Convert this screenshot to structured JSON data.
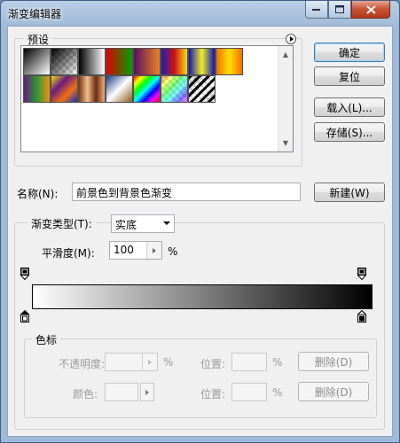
{
  "window": {
    "title": "渐变编辑器"
  },
  "presets": {
    "label": "预设",
    "swatches": [
      {
        "name": "foreground-to-background",
        "bg": "linear-gradient(135deg,#000,#fff)"
      },
      {
        "name": "foreground-to-transparent",
        "bg": "linear-gradient(135deg,#000,rgba(0,0,0,0))"
      },
      {
        "name": "black-white",
        "bg": "linear-gradient(to right,#000,#fff)"
      },
      {
        "name": "red-green",
        "bg": "linear-gradient(to right,#e00000,#00a000)"
      },
      {
        "name": "violet-orange",
        "bg": "linear-gradient(to right,#5a1060,#f08020)"
      },
      {
        "name": "blue-red-yellow",
        "bg": "linear-gradient(to right,#1020c0,#d01010,#f0e010)"
      },
      {
        "name": "blue-yellow-blue",
        "bg": "linear-gradient(to right,#1010c0,#f0f020,#1010c0)"
      },
      {
        "name": "orange-yellow-orange",
        "bg": "linear-gradient(to right,#f07000,#ffe000,#f07000)"
      },
      {
        "name": "violet-green-orange",
        "bg": "linear-gradient(to right,#6a1a80,#2a9a30,#f09010)"
      },
      {
        "name": "yellow-violet-orange-blue",
        "bg": "linear-gradient(135deg,#f0e010,#6a1a80,#f07010,#1030c0)"
      },
      {
        "name": "copper",
        "bg": "linear-gradient(to right,#7a3a10,#f0c090,#6a2a10,#f0b080)"
      },
      {
        "name": "chrome",
        "bg": "linear-gradient(135deg,#1a3a8a,#ffffff 50%,#8a5a20)"
      },
      {
        "name": "spectrum",
        "bg": "linear-gradient(135deg,#f00,#ff0,#0f0,#0ff,#00f,#f0f,#f00)"
      },
      {
        "name": "transparent-rainbow",
        "bg": "linear-gradient(135deg,#ff000080,#ffff0080,#00ff0080,#00ffff80,#0000ff80,#ff00ff80)"
      },
      {
        "name": "transparent-stripes",
        "bg": "repeating-linear-gradient(135deg,#000 0 3px,transparent 3px 7px)"
      }
    ]
  },
  "buttons": {
    "ok": "确定",
    "reset": "复位",
    "load": "载入(L)...",
    "save": "存储(S)...",
    "new": "新建(W)"
  },
  "name_field": {
    "label": "名称(N):",
    "value": "前景色到背景色渐变"
  },
  "gradient_type": {
    "label": "渐变类型(T):",
    "value": "实底"
  },
  "smoothness": {
    "label": "平滑度(M):",
    "value": "100",
    "unit": "%"
  },
  "gradient": {
    "start_color": "#ffffff",
    "end_color": "#000000"
  },
  "stops_group": {
    "label": "色标",
    "opacity_label": "不透明度:",
    "opacity_unit": "%",
    "location_label_1": "位置:",
    "location_unit_1": "%",
    "delete_label_1": "删除(D)",
    "color_label": "颜色:",
    "location_label_2": "位置:",
    "location_unit_2": "%",
    "delete_label_2": "删除(D)"
  }
}
